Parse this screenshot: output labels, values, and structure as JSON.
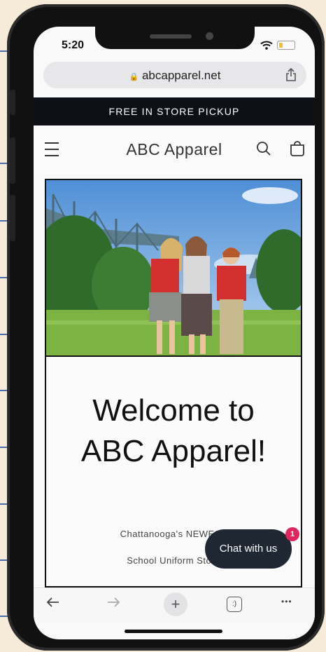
{
  "status_bar": {
    "time": "5:20"
  },
  "browser": {
    "url": "abcapparel.net",
    "lock_glyph": "🔒",
    "new_tab_glyph": "+",
    "tabs_glyph": ":)",
    "more_glyph": "•••"
  },
  "announcement": {
    "text": "FREE IN STORE PICKUP"
  },
  "header": {
    "title": "ABC Apparel"
  },
  "hero": {
    "welcome": "Welcome to ABC Apparel!",
    "tagline_line1": "Chattanooga's NEWEST",
    "tagline_line2": "School Uniform Store"
  },
  "chat": {
    "label": "Chat with us",
    "badge": "1"
  },
  "colors": {
    "announcement_bg": "#0d1117",
    "chat_bg": "#1f2733",
    "badge": "#e0245e",
    "page_bg": "#f6ead9"
  }
}
